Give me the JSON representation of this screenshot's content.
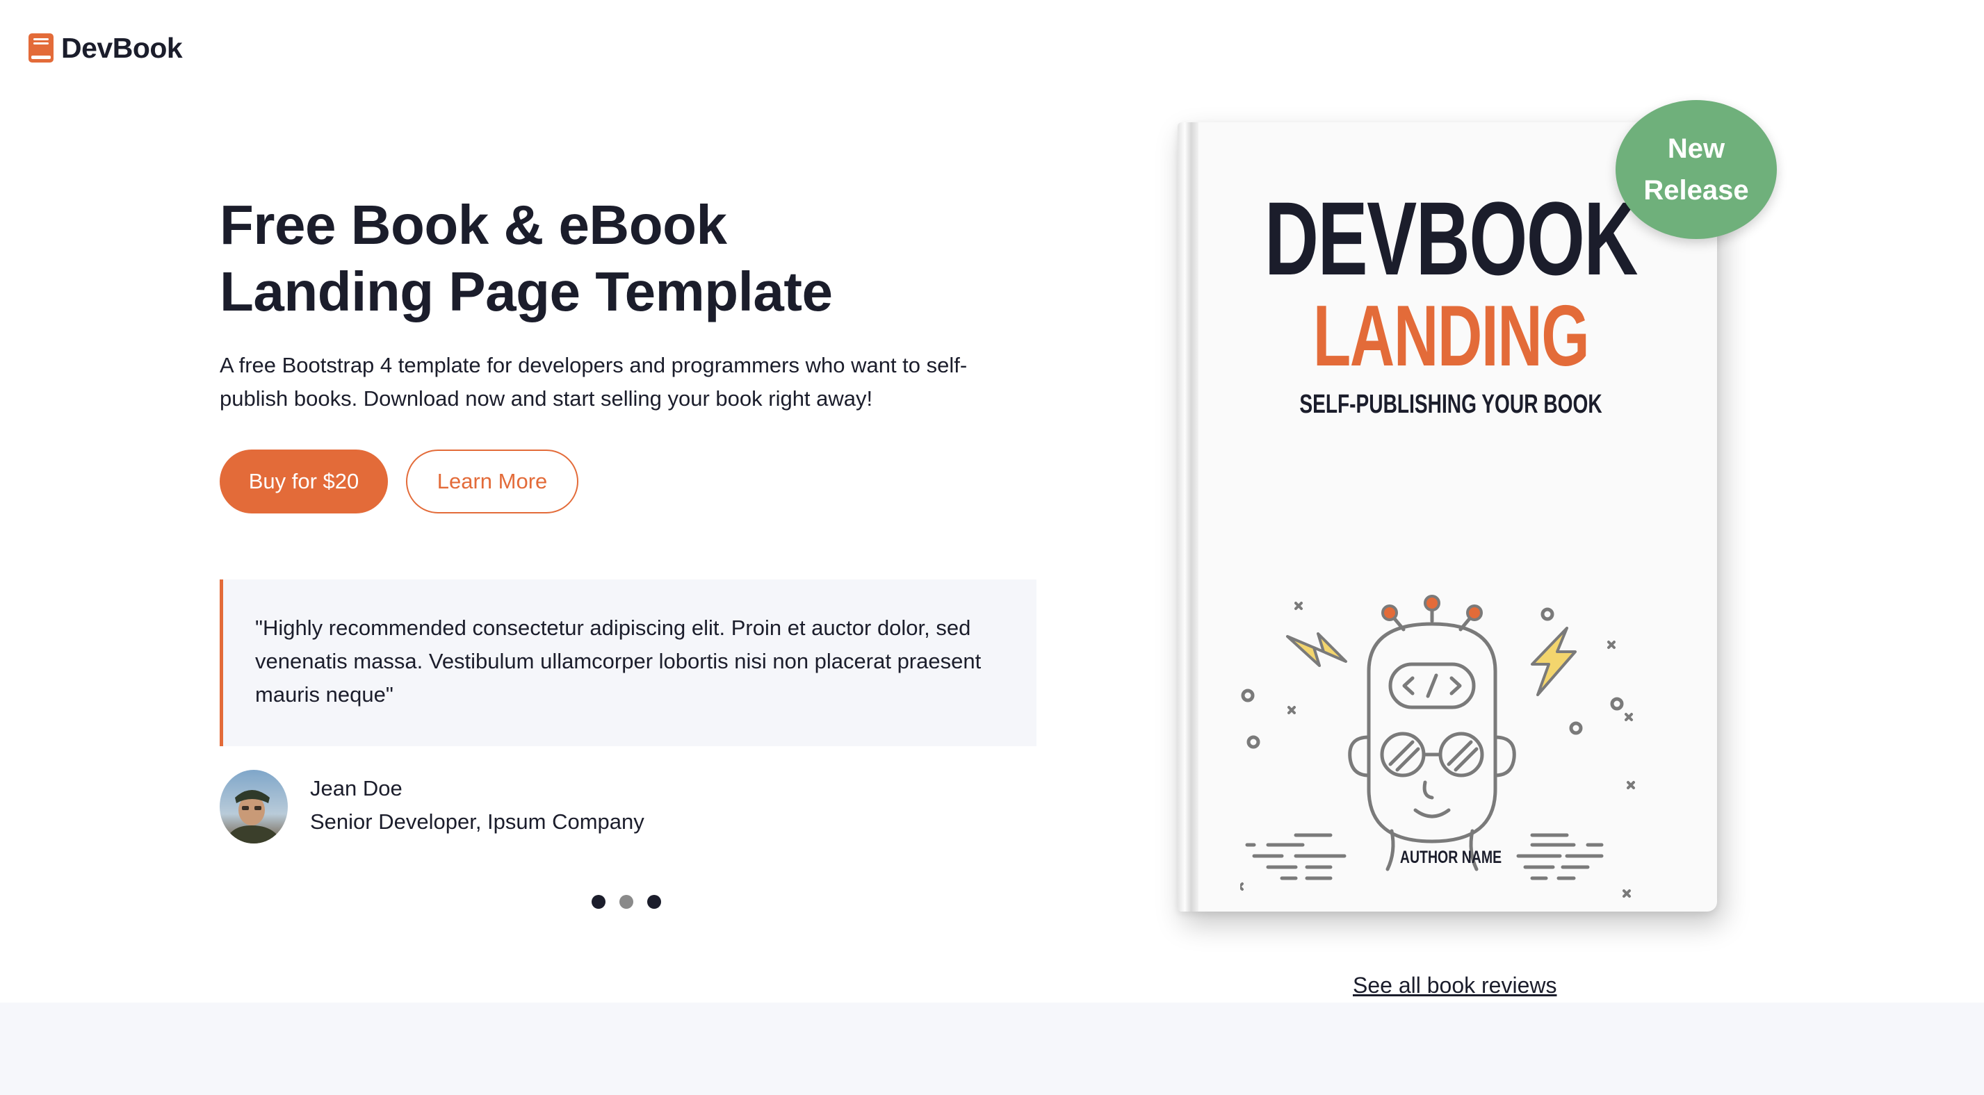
{
  "brand": {
    "name": "DevBook",
    "icon": "book-icon",
    "accent": "#e36b39"
  },
  "hero": {
    "title_line1": "Free Book & eBook",
    "title_line2": "Landing Page Template",
    "intro": "A free Bootstrap 4 template for developers and programmers who want to self-publish books. Download now and start selling your book right away!",
    "buy_label": "Buy for $20",
    "learn_label": "Learn More"
  },
  "testimonial": {
    "quote": "\"Highly recommended consectetur adipiscing elit. Proin et auctor dolor, sed venenatis massa. Vestibulum ullamcorper lobortis nisi non placerat praesent mauris neque\"",
    "author": "Jean Doe",
    "role": "Senior Developer, Ipsum Company",
    "carousel_dots": 3,
    "active_dot": 2
  },
  "book": {
    "title1": "DEVBOOK",
    "title2": "LANDING",
    "subtitle": "SELF-PUBLISHING YOUR BOOK",
    "author": "AUTHOR NAME",
    "illustration": "developer-head-icon"
  },
  "badge": {
    "line1": "New",
    "line2": "Release",
    "color": "#6fb07b"
  },
  "reviews_link": "See all book reviews",
  "colors": {
    "text": "#1b1d2b",
    "accent": "#e36b39",
    "quote_bg": "#f5f6fa",
    "band_bg": "#f6f7fb"
  }
}
